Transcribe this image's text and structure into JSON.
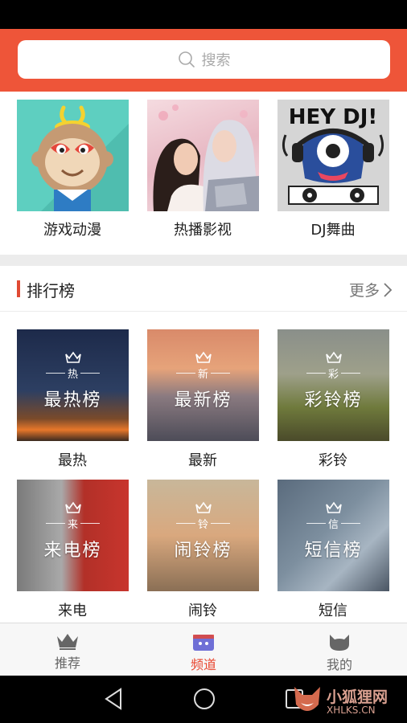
{
  "search": {
    "placeholder": "搜索"
  },
  "channels": [
    {
      "label": "游戏动漫",
      "icon": "monkey-king-mascot"
    },
    {
      "label": "热播影视",
      "icon": "drama-couple-photo"
    },
    {
      "label": "DJ舞曲",
      "icon": "hey-dj-monster",
      "art_text": "HEY DJ!"
    }
  ],
  "ranking": {
    "title": "排行榜",
    "more": "更多",
    "items": [
      {
        "mini": "热",
        "big": "最热榜",
        "label": "最热"
      },
      {
        "mini": "新",
        "big": "最新榜",
        "label": "最新"
      },
      {
        "mini": "彩",
        "big": "彩铃榜",
        "label": "彩铃"
      },
      {
        "mini": "来",
        "big": "来电榜",
        "label": "来电"
      },
      {
        "mini": "铃",
        "big": "闹铃榜",
        "label": "闹铃"
      },
      {
        "mini": "信",
        "big": "短信榜",
        "label": "短信"
      }
    ]
  },
  "bottom_nav": [
    {
      "label": "推荐",
      "icon": "crown-icon",
      "active": false
    },
    {
      "label": "频道",
      "icon": "tv-icon",
      "active": true
    },
    {
      "label": "我的",
      "icon": "cat-icon",
      "active": false
    }
  ],
  "watermark": {
    "line1": "小狐狸网",
    "line2": "XHLKS.CN"
  },
  "colors": {
    "accent": "#ee5539",
    "active_tab": "#e8452f"
  }
}
